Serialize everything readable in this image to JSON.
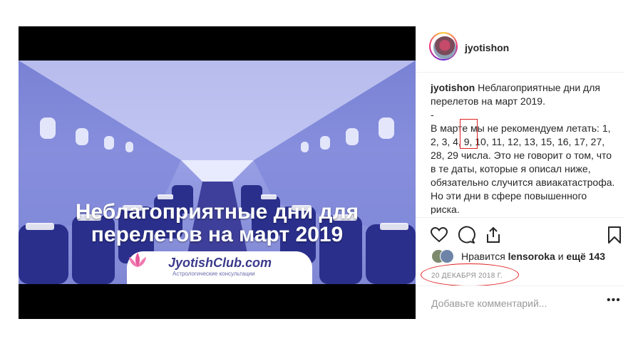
{
  "post": {
    "overlay_title_line1": "Неблагоприятные дни для",
    "overlay_title_line2": "перелетов на март 2019",
    "logo_text": "JyotishClub.com",
    "logo_subtext": "Астрологические консультации"
  },
  "header": {
    "username": "jyotishon"
  },
  "caption": {
    "username": "jyotishon",
    "text": " Неблагоприятные дни для перелетов на март 2019.\n-\nВ марте мы не рекомендуем летать: 1, 2, 3, 4, 9, 10, 11, 12, 13, 15, 16, 17, 27, 28, 29 числа. Это не говорит о том, что в те даты, которые я описал ниже, обязательно случится авиакатастрофа. Но эти дни в сфере повышенного риска.\n\nВторник и суббота считаются в целом не"
  },
  "actions": {
    "like": "heart-icon",
    "comment": "comment-icon",
    "share": "share-icon",
    "save": "bookmark-icon"
  },
  "likes": {
    "prefix": "Нравится ",
    "user": "lensoroka",
    "suffix": " и ",
    "others": "ещё 143"
  },
  "date": "20 ДЕКАБРЯ 2018 Г.",
  "comment": {
    "placeholder": "Добавьте комментарий...",
    "more": "•••"
  },
  "colors": {
    "highlight": "#e02020",
    "secondary_text": "#8e8e8e"
  }
}
